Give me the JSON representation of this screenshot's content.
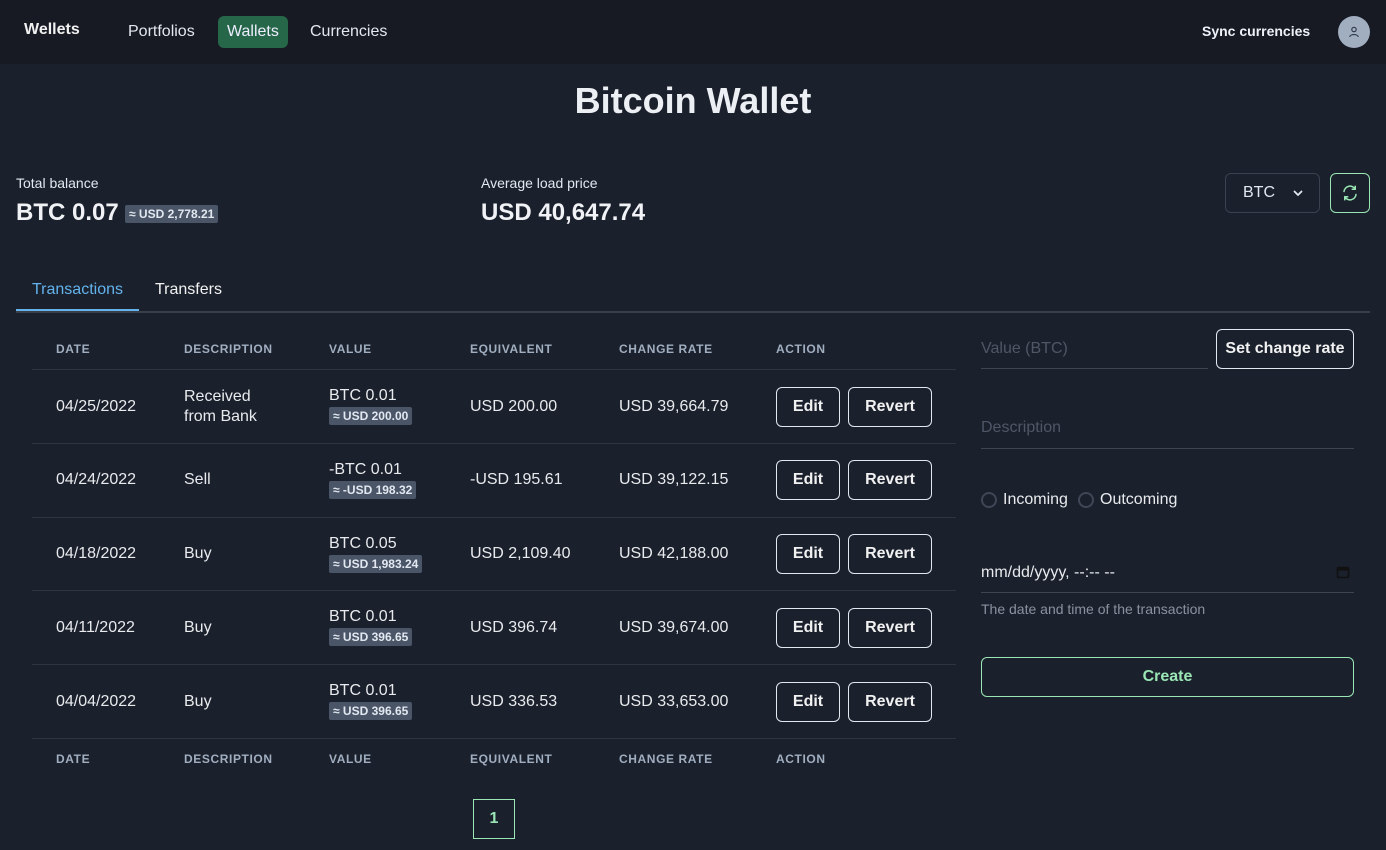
{
  "navbar": {
    "brand": "Wellets",
    "links": [
      {
        "label": "Portfolios",
        "active": false
      },
      {
        "label": "Wallets",
        "active": true
      },
      {
        "label": "Currencies",
        "active": false
      }
    ],
    "sync_label": "Sync currencies",
    "avatar_icon": "user-icon"
  },
  "page": {
    "title": "Bitcoin Wallet"
  },
  "stats": {
    "total_balance_label": "Total balance",
    "total_balance_value": "BTC 0.07",
    "total_balance_equiv": "≈ USD 2,778.21",
    "avg_price_label": "Average load price",
    "avg_price_value": "USD 40,647.74"
  },
  "currency_select": {
    "selected": "BTC",
    "refresh_icon": "refresh-icon"
  },
  "tabs": [
    {
      "label": "Transactions",
      "active": true
    },
    {
      "label": "Transfers",
      "active": false
    }
  ],
  "table": {
    "headers": [
      "DATE",
      "DESCRIPTION",
      "VALUE",
      "EQUIVALENT",
      "CHANGE RATE",
      "ACTION"
    ],
    "rows": [
      {
        "date": "04/25/2022",
        "description_line1": "Received",
        "description_line2": "from Bank",
        "value": "BTC 0.01",
        "value_equiv": "≈ USD 200.00",
        "equivalent": "USD 200.00",
        "change_rate": "USD 39,664.79"
      },
      {
        "date": "04/24/2022",
        "description_line1": "Sell",
        "description_line2": "",
        "value": "-BTC 0.01",
        "value_equiv": "≈ -USD 198.32",
        "equivalent": "-USD 195.61",
        "change_rate": "USD 39,122.15"
      },
      {
        "date": "04/18/2022",
        "description_line1": "Buy",
        "description_line2": "",
        "value": "BTC 0.05",
        "value_equiv": "≈ USD 1,983.24",
        "equivalent": "USD 2,109.40",
        "change_rate": "USD 42,188.00"
      },
      {
        "date": "04/11/2022",
        "description_line1": "Buy",
        "description_line2": "",
        "value": "BTC 0.01",
        "value_equiv": "≈ USD 396.65",
        "equivalent": "USD 396.74",
        "change_rate": "USD 39,674.00"
      },
      {
        "date": "04/04/2022",
        "description_line1": "Buy",
        "description_line2": "",
        "value": "BTC 0.01",
        "value_equiv": "≈ USD 396.65",
        "equivalent": "USD 336.53",
        "change_rate": "USD 33,653.00"
      }
    ],
    "edit_label": "Edit",
    "revert_label": "Revert"
  },
  "pagination": {
    "current_page": "1"
  },
  "form": {
    "value_placeholder": "Value (BTC)",
    "set_rate_label": "Set change rate",
    "description_placeholder": "Description",
    "radio_incoming": "Incoming",
    "radio_outcoming": "Outcoming",
    "datetime_placeholder": "mm/dd/yyyy, --:-- --",
    "datetime_helper": "The date and time of the transaction",
    "create_label": "Create"
  },
  "colors": {
    "accent_green": "#9ae6b4",
    "nav_active": "#276749",
    "tab_active": "#63b3ed"
  }
}
